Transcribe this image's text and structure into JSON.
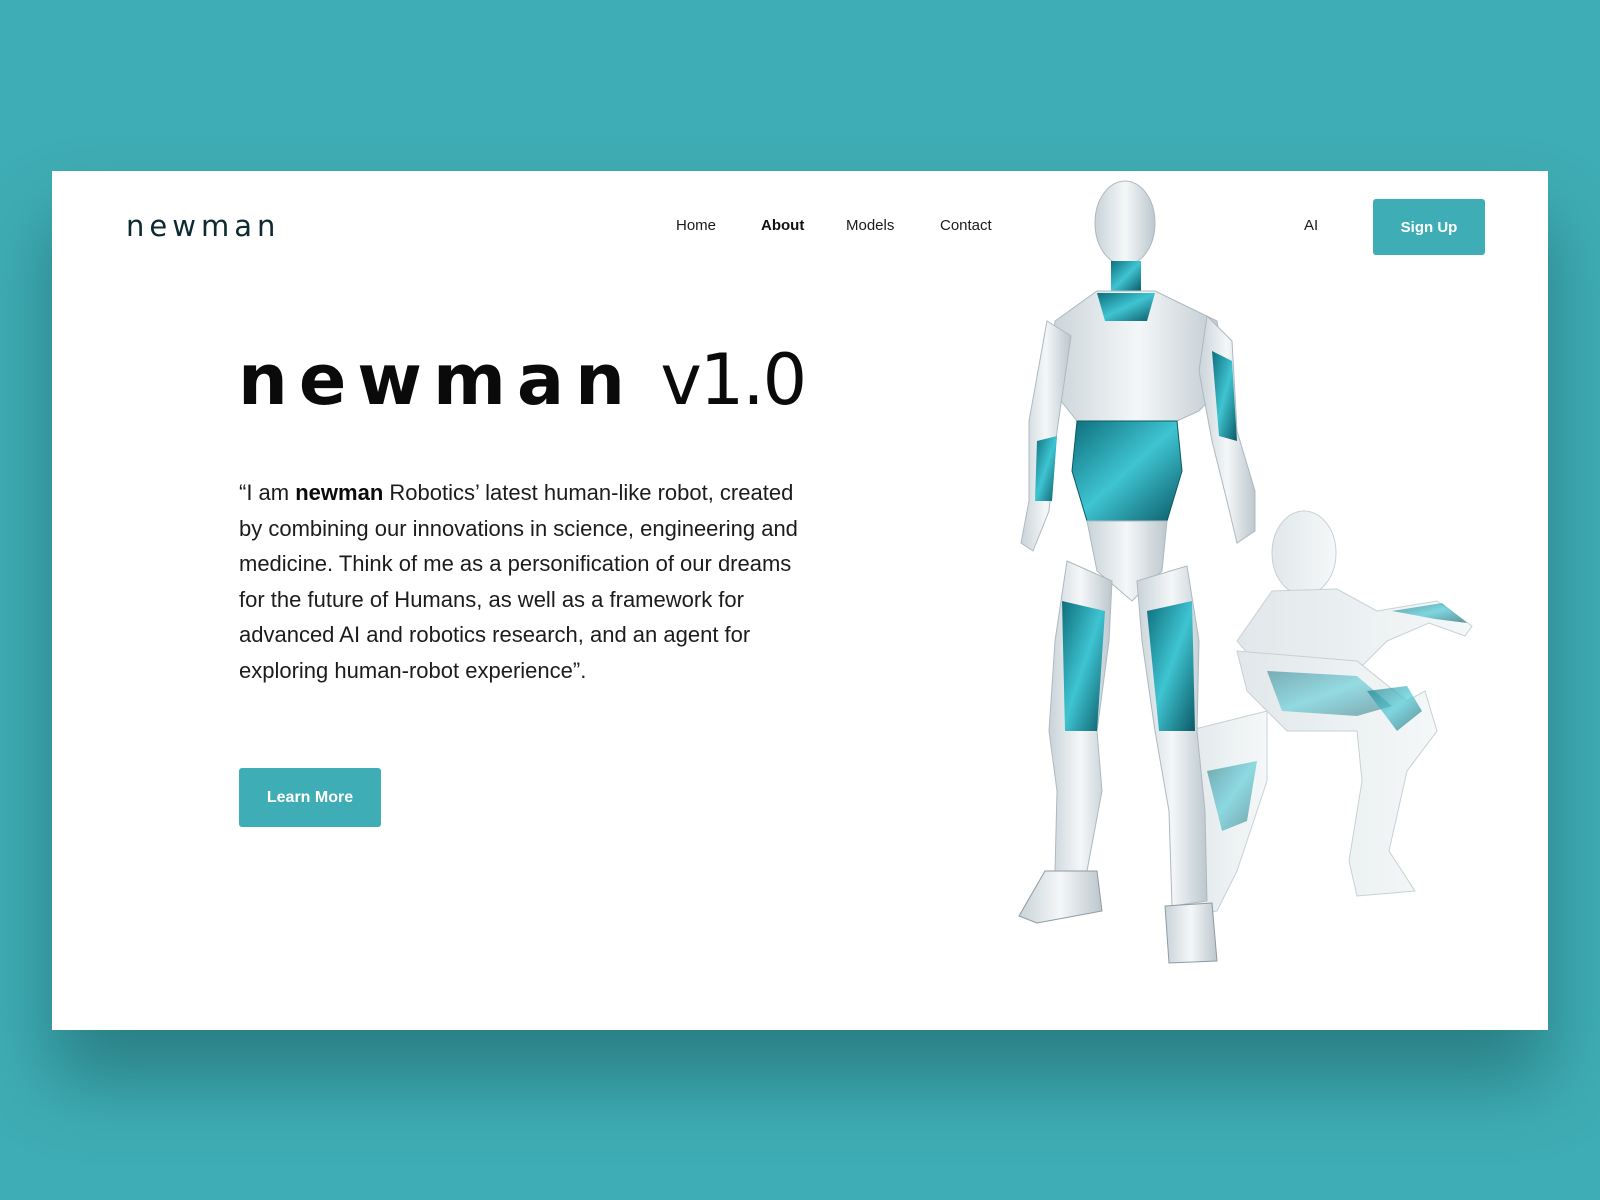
{
  "header": {
    "logo": "newman",
    "nav": [
      {
        "label": "Home",
        "active": false
      },
      {
        "label": "About",
        "active": true
      },
      {
        "label": "Models",
        "active": false
      },
      {
        "label": "Contact",
        "active": false
      }
    ],
    "ai_link": "AI",
    "signup_label": "Sign Up"
  },
  "hero": {
    "title_brand": "newman",
    "title_version": "v1.0",
    "paragraph_open": "“I am ",
    "paragraph_brand": "newman",
    "paragraph_rest": " Robotics’ latest human-like robot, created by combining our innovations in science, engineering and medicine. Think of me as a personification of our dreams for the future of Humans, as well as a framework for advanced AI and robotics research, and an agent for exploring human-robot experience”.",
    "learn_more_label": "Learn More"
  },
  "colors": {
    "background": "#3FADB5",
    "accent": "#3FADB5",
    "card": "#FFFFFF",
    "robot_body": "#E6ECEF",
    "robot_accent": "#1C8C9A"
  },
  "images": {
    "robots": "two white humanoid robots with teal accents, one standing, one crouching"
  }
}
